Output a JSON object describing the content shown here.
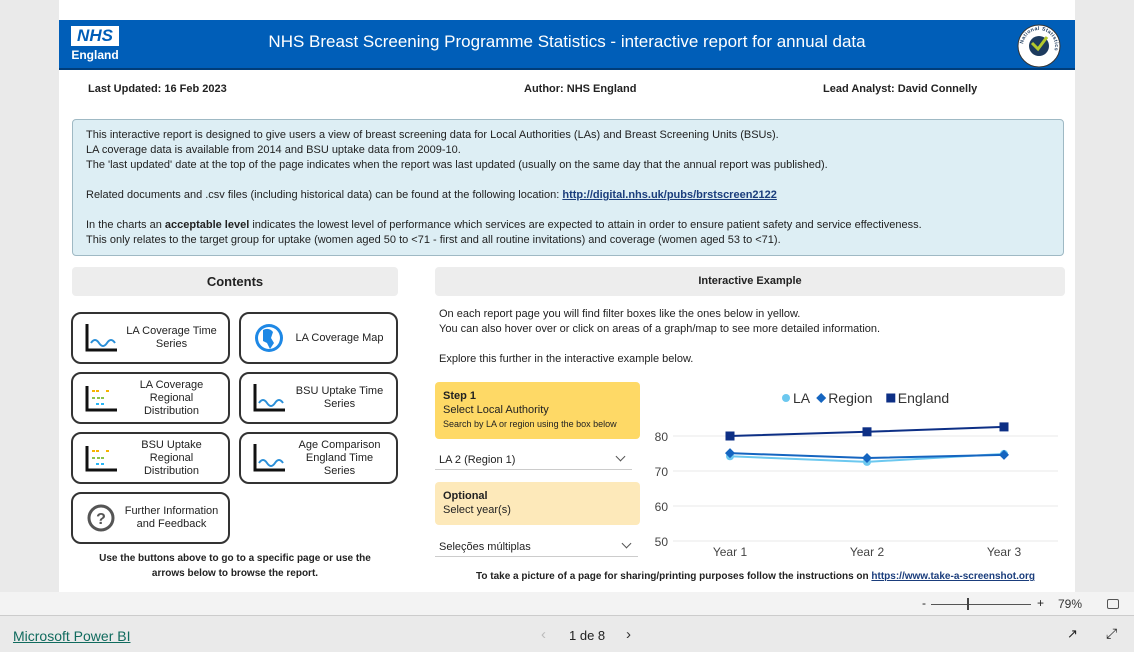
{
  "header": {
    "title": "NHS Breast Screening Programme Statistics - interactive report for annual data",
    "logo_text": "NHS England",
    "logo_nhs": "NHS",
    "logo_england": "England",
    "badge_text": "National Statistics"
  },
  "meta": {
    "last_updated": "Last Updated: 16 Feb 2023",
    "author": "Author:  NHS England",
    "lead_analyst": "Lead Analyst: David Connelly"
  },
  "info": {
    "line1": "This interactive report is designed to give users a view of breast screening data for Local Authorities (LAs) and Breast Screening Units (BSUs).",
    "line2": "LA coverage data is available from 2014 and BSU uptake data from 2009-10.",
    "line3": "The 'last updated' date at the top of the page indicates when the report was last updated (usually on the same day that the annual report was published).",
    "line4": "Related documents and .csv files (including historical data) can be found at the following location: ",
    "link": "http://digital.nhs.uk/pubs/brstscreen2122",
    "line5a": "In the charts an ",
    "line5b": "acceptable level",
    "line5c": " indicates the lowest level of performance which services are expected to attain in order to ensure patient safety and service effectiveness.",
    "line6": "This only relates to the target group for uptake (women aged 50 to <71 - first and all routine invitations) and coverage (women aged 53 to <71)."
  },
  "contents": {
    "title": "Contents",
    "buttons": [
      {
        "label": "LA Coverage Time Series",
        "icon": "line-chart-icon"
      },
      {
        "label": "LA Coverage Map",
        "icon": "globe-icon"
      },
      {
        "label": "LA Coverage Regional Distribution",
        "icon": "dot-plot-icon"
      },
      {
        "label": "BSU Uptake Time Series",
        "icon": "line-chart-icon"
      },
      {
        "label": "BSU Uptake Regional Distribution",
        "icon": "dot-plot-icon"
      },
      {
        "label": "Age Comparison England Time Series",
        "icon": "line-chart-icon"
      },
      {
        "label": "Further Information and Feedback",
        "icon": "question-icon"
      }
    ],
    "footer": "Use the buttons above to go to a specific page or use the arrows below to browse the report."
  },
  "example": {
    "title": "Interactive Example",
    "text1": "On each report page you will find filter boxes like the ones below in yellow.",
    "text2": "You can also hover over or click on areas of a graph/map to see more detailed information.",
    "text3": "Explore this further in the interactive example below.",
    "step1_title": "Step 1",
    "step1_sub": "Select Local Authority",
    "step1_hint": "Search by LA or region using the box below",
    "la_select": "LA 2 (Region 1)",
    "optional_title": "Optional",
    "optional_sub": "Select year(s)",
    "year_select": "Seleções múltiplas",
    "footer_text": "To take a picture of a page for sharing/printing purposes follow the instructions on ",
    "footer_link": "https://www.take-a-screenshot.org"
  },
  "chart_data": {
    "type": "line",
    "categories": [
      "Year 1",
      "Year 2",
      "Year 3"
    ],
    "ylim": [
      50,
      85
    ],
    "yticks": [
      50,
      60,
      70,
      80
    ],
    "grid": true,
    "legend_position": "top",
    "series": [
      {
        "name": "LA",
        "values": [
          74.2,
          72.6,
          74.9
        ],
        "color": "#6cc8ef",
        "marker": "circle"
      },
      {
        "name": "Region",
        "values": [
          75.1,
          73.7,
          74.6
        ],
        "color": "#1565c0",
        "marker": "diamond"
      },
      {
        "name": "England",
        "values": [
          80.0,
          81.2,
          82.6
        ],
        "color": "#0d2f85",
        "marker": "square"
      }
    ]
  },
  "viewer": {
    "zoom": "79%",
    "zoom_level": 79,
    "zoom_minus": "-",
    "zoom_plus": "+",
    "brand": "Microsoft Power BI",
    "page": "1 de 8"
  }
}
